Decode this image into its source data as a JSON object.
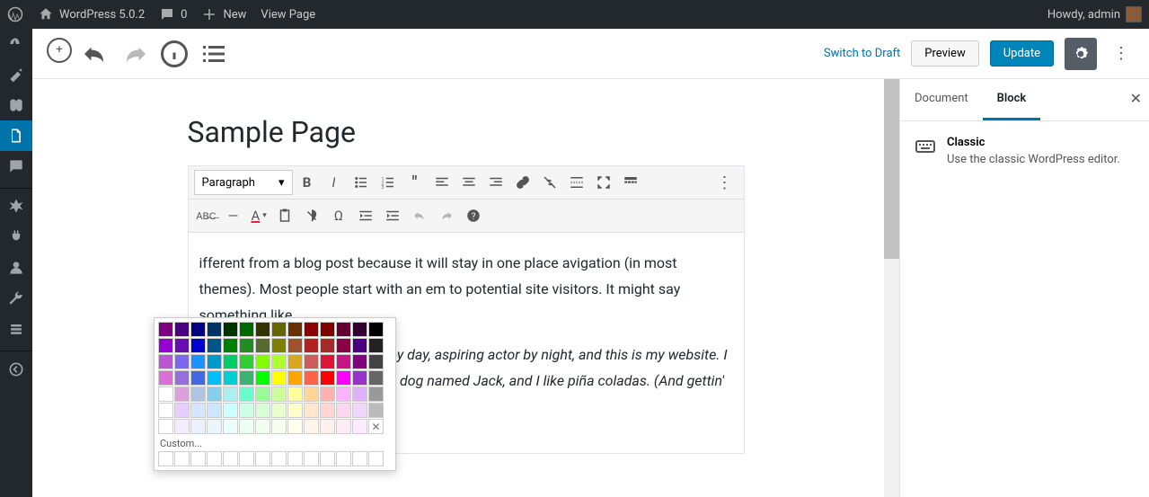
{
  "adminbar": {
    "site_title": "WordPress 5.0.2",
    "comments_count": "0",
    "new_label": "New",
    "view_page": "View Page",
    "howdy": "Howdy, admin"
  },
  "topbar": {
    "switch_draft": "Switch to Draft",
    "preview": "Preview",
    "update": "Update"
  },
  "page": {
    "title": "Sample Page",
    "format_selector": "Paragraph",
    "para1": "ifferent from a blog post because it will stay in one place avigation (in most themes). Most people start with an em to potential site visitors. It might say something like",
    "para2": "Hi there! I'm a bike messenger by day, aspiring actor by night, and this is my website. I live in Los Angeles, have a great dog named Jack, and I like piña coladas. (And gettin' caught in the rain.)"
  },
  "colorpicker": {
    "custom_label": "Custom...",
    "rows": [
      [
        "#800080",
        "#4B0082",
        "#000080",
        "#003366",
        "#003300",
        "#006600",
        "#333300",
        "#666600",
        "#663300",
        "#8B0000",
        "#800000",
        "#660033",
        "#330033",
        "#000000"
      ],
      [
        "#9400D3",
        "#6A0DAD",
        "#0000CD",
        "#005588",
        "#008000",
        "#228B22",
        "#556B2F",
        "#808000",
        "#A0522D",
        "#B22222",
        "#A52A2A",
        "#8B0045",
        "#4B0082",
        "#222222"
      ],
      [
        "#BA55D3",
        "#7B68EE",
        "#1E90FF",
        "#0099CC",
        "#00CC66",
        "#32CD32",
        "#7FFF00",
        "#ADFF2F",
        "#DAA520",
        "#CD5C5C",
        "#DC143C",
        "#C71585",
        "#800080",
        "#444444"
      ],
      [
        "#DA70D6",
        "#9370DB",
        "#4169E1",
        "#00BFFF",
        "#00CED1",
        "#3CB371",
        "#00FF00",
        "#FFFF00",
        "#FFA500",
        "#FF6347",
        "#FF0000",
        "#FF00FF",
        "#9932CC",
        "#666666"
      ],
      [
        "#FFFFFF",
        "#DDA0DD",
        "#B0C4DE",
        "#87CEEB",
        "#AFEEEE",
        "#66FFCC",
        "#98FB98",
        "#CCFF99",
        "#FFFF99",
        "#FFD699",
        "#FFB2B2",
        "#FFB2FF",
        "#E0B0FF",
        "#999999"
      ],
      [
        "#FFFFFF",
        "#E6CCFF",
        "#D6E6FF",
        "#CCE6FF",
        "#CCFFFF",
        "#CCFFE6",
        "#D6FFD6",
        "#E6FFCC",
        "#FFFFCC",
        "#FFE6CC",
        "#FFD6D6",
        "#FFD6F0",
        "#F0D6FF",
        "#BBBBBB"
      ],
      [
        "#FFFFFF",
        "#F5EBFF",
        "#EBF0FF",
        "#EBF5FF",
        "#EBFFFF",
        "#EBFFF5",
        "#F0FFF0",
        "#F5FFEB",
        "#FFFFEB",
        "#FFF5EB",
        "#FFF0F0",
        "#FFEBF5",
        "#FAEBFF",
        ""
      ]
    ]
  },
  "sidebar": {
    "tab_document": "Document",
    "tab_block": "Block",
    "block_name": "Classic",
    "block_desc": "Use the classic WordPress editor."
  }
}
